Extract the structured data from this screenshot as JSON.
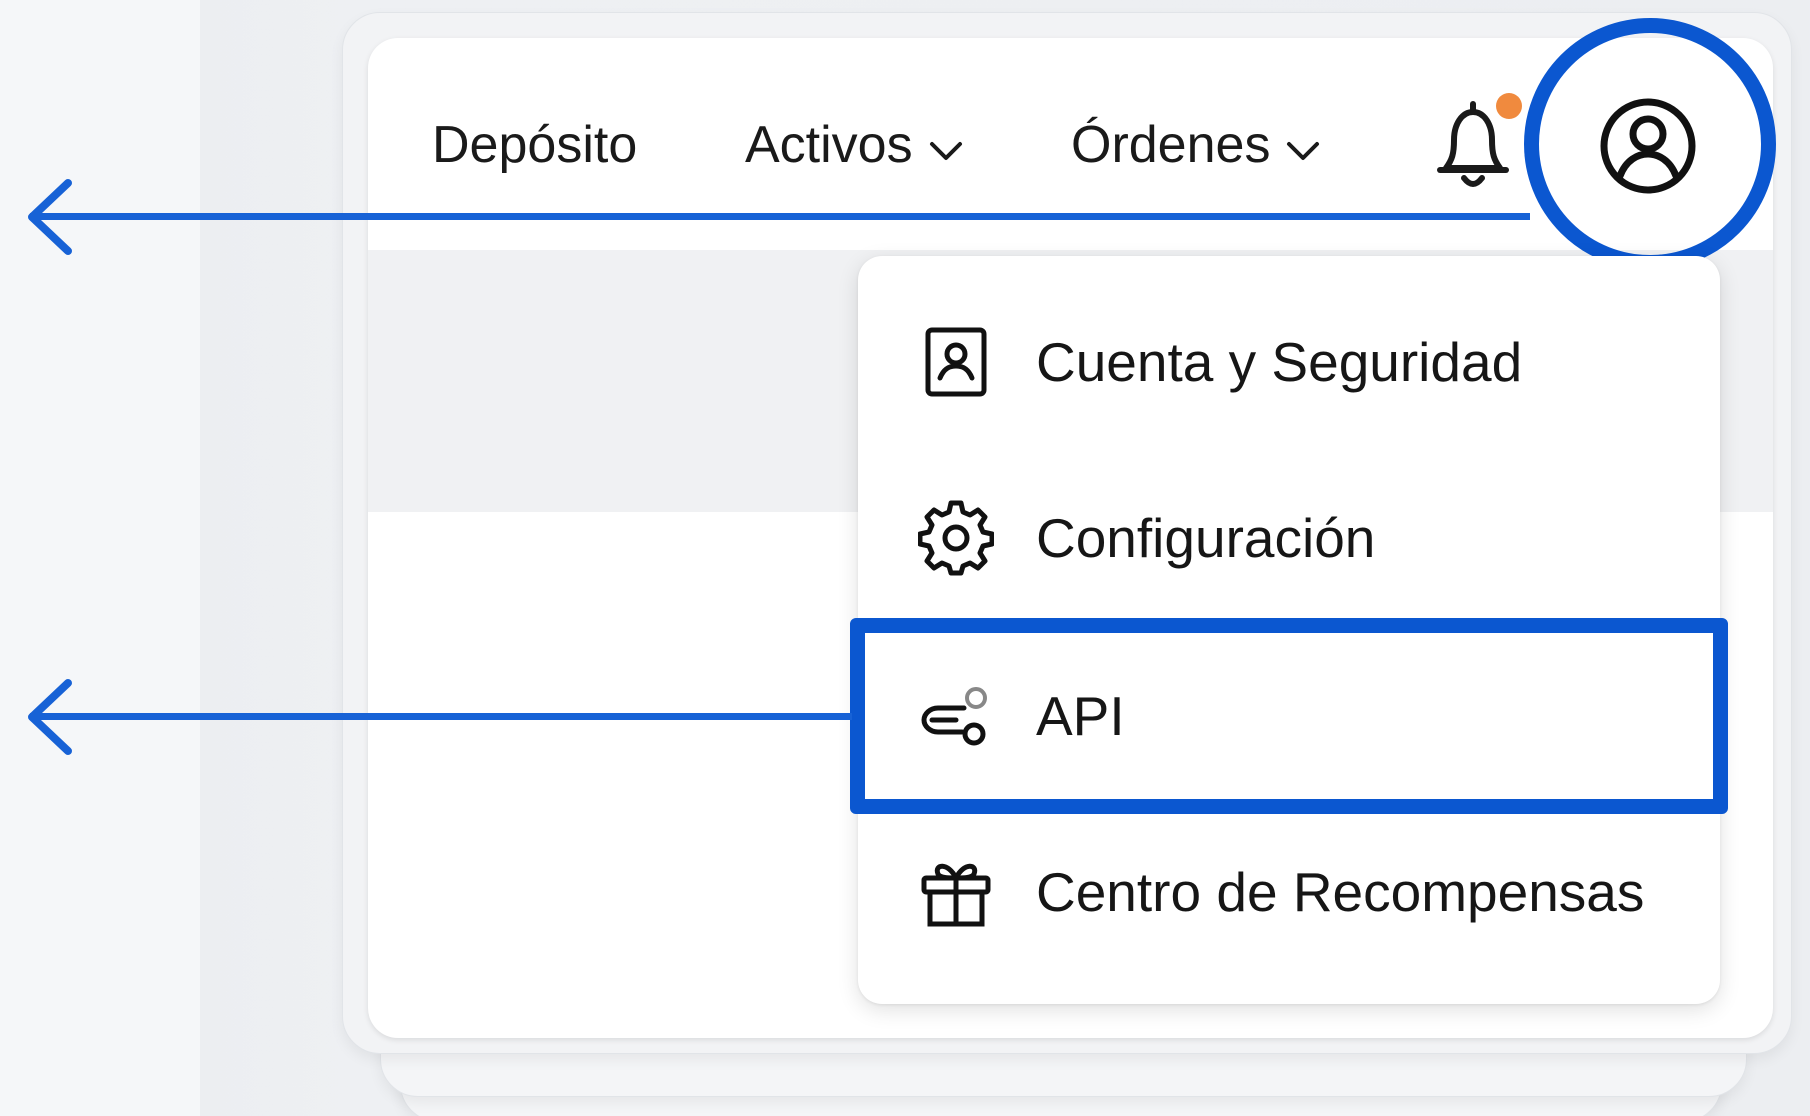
{
  "nav": {
    "deposito": "Depósito",
    "activos": "Activos",
    "ordenes": "Órdenes",
    "bell_icon": "bell-icon",
    "avatar_icon": "user-circle-icon"
  },
  "menu": {
    "items": [
      {
        "label": "Cuenta y Seguridad",
        "icon": "id-badge-icon"
      },
      {
        "label": "Configuración",
        "icon": "gear-icon"
      },
      {
        "label": "API",
        "icon": "api-connection-icon"
      },
      {
        "label": "Centro de Recompensas",
        "icon": "gift-icon"
      }
    ]
  },
  "colors": {
    "highlight": "#0b57d0",
    "arrow": "#1762d6",
    "notification_dot": "#f08a3e"
  }
}
